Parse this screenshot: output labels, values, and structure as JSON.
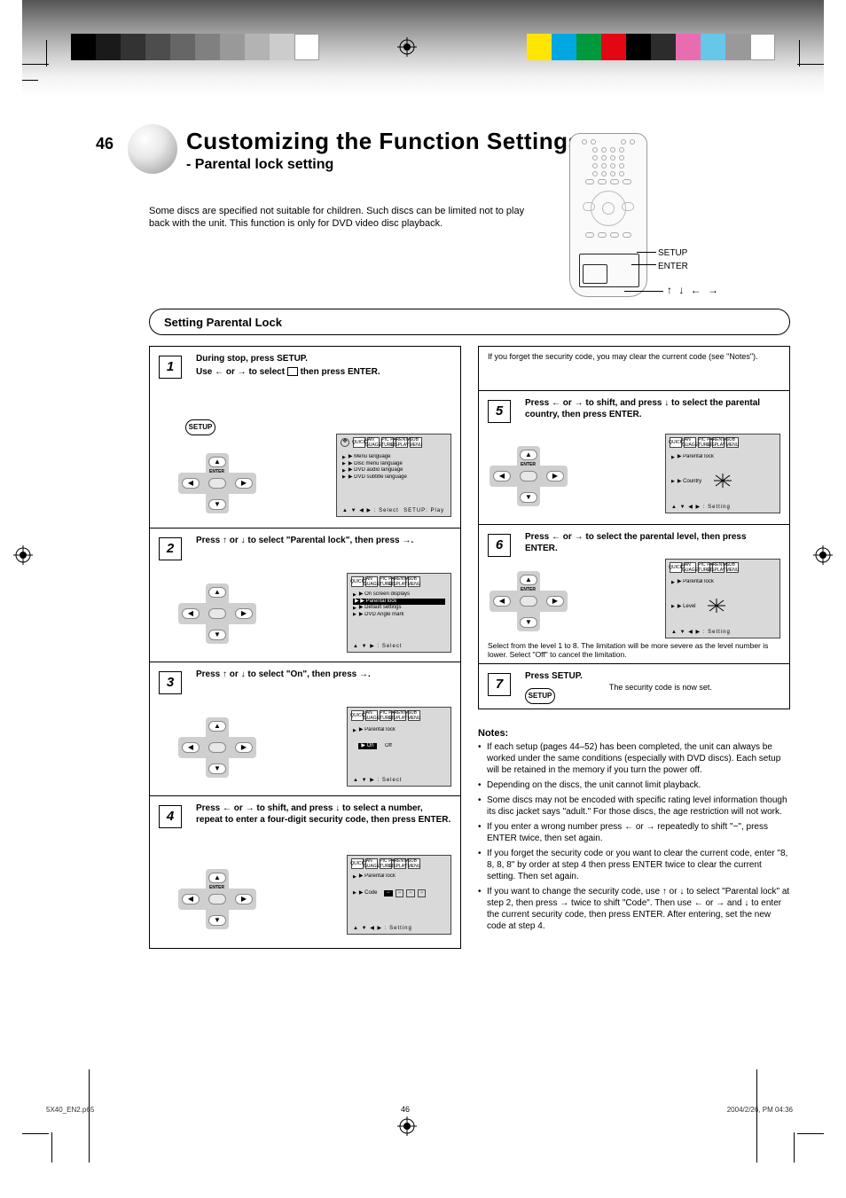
{
  "page_number": "46",
  "title": "Customizing the Function Settings",
  "subtitle": "- Parental lock setting",
  "intro": "Some discs are specified not suitable for children. Such discs can be limited not to play back with the unit. This function is only for DVD video disc playback.",
  "remote": {
    "callout_enter": "ENTER",
    "arrows_label": "↑ ↓ ← →"
  },
  "section_title": "Setting Parental Lock",
  "osd_icons": [
    "QUICK",
    "LAN GUAGE",
    "PIC TURE",
    "PARENTAL DISPLAY",
    "SUB MENU"
  ],
  "osd_common": {
    "nav4": "▲ ▼ ◀ ▶",
    "nav3": "▲ ▼ ▶",
    "select_tag": "Select",
    "setting_tag": "Setting",
    "play_tag": "Play"
  },
  "steps": [
    {
      "num": "1",
      "text_a": "During stop, press SETUP.",
      "text_b": "Use ← or → to select",
      "text_c": "then press ENTER.",
      "btn": "SETUP",
      "osd": {
        "has_ring": true,
        "lines": [
          "▶ Menu language",
          "▶ Disc menu language",
          "▶ DVD audio language",
          "▶ DVD subtitle language"
        ],
        "nav": "nav4"
      }
    },
    {
      "num": "2",
      "text_a": "Press ↑ or ↓ to select \"Parental lock\", then press →.",
      "osd": {
        "lines": [
          "▶ On screen displays",
          "▶ Parental lock",
          "▶ Default settings",
          "▶ DVD Angle mark"
        ],
        "hl_index": 1,
        "nav": "nav3"
      }
    },
    {
      "num": "3",
      "text_a": "Press ↑ or ↓ to select \"On\", then press →.",
      "osd": {
        "lines": [
          "▶ Parental lock",
          "",
          "Off"
        ],
        "inv_on": "On",
        "nav": "nav3"
      }
    },
    {
      "num": "4",
      "text_a": "Press ← or → to shift, and press ↓ to select a number, repeat to enter a four-digit security code, then press ENTER.",
      "osd": {
        "lines": [
          "▶ Parental lock",
          "",
          "▶ Code"
        ],
        "code_boxes": true,
        "nav": "nav4"
      },
      "note": "If you forget the security code, you may clear the current code (see \"Notes\")."
    },
    {
      "num": "5",
      "text_a": "Press ← or → to shift, and press ↓ to select the parental country, then press ENTER.",
      "osd": {
        "lines": [
          "▶ Parental lock",
          "",
          "▶ Country"
        ],
        "starburst": true,
        "nav": "nav4"
      }
    },
    {
      "num": "6",
      "text_a": "Press ← or → to select the parental level, then press ENTER.",
      "osd": {
        "lines": [
          "▶ Parental lock",
          "",
          "▶ Level"
        ],
        "starburst": true,
        "nav": "nav4"
      },
      "note": "Select from the level 1 to 8. The limitation will be more severe as the level number is lower. Select \"Off\" to cancel the limitation."
    },
    {
      "num": "7",
      "text_a": "Press SETUP.",
      "btn": "SETUP",
      "note": "The security code is now set."
    }
  ],
  "notes": {
    "header": "Notes:",
    "items": [
      "If each setup (pages 44–52) has been completed, the unit can always be worked under the same conditions (especially with DVD discs). Each setup will be retained in the memory if you turn the power off.",
      "Depending on the discs, the unit cannot limit playback.",
      "Some discs may not be encoded with specific rating level information though its disc jacket says \"adult.\" For those discs, the age restriction will not work.",
      "If you enter a wrong number press ← or → repeatedly to shift \"−\", press ENTER twice, then set again.",
      "If you forget the security code or you want to clear the current code, enter \"8, 8, 8, 8\" by order at step 4 then press ENTER twice to clear the current setting. Then set again.",
      "If you want to change the security code, use ↑ or ↓ to select \"Parental lock\" at step 2, then press → twice to shift \"Code\". Then use ← or → and ↓ to enter the current security code, then press ENTER. After entering, set the new code at step 4."
    ]
  },
  "footer": {
    "stamp": "5X40_EN2.p65",
    "page": "46",
    "date": "2004/2/26, PM 04:36"
  }
}
